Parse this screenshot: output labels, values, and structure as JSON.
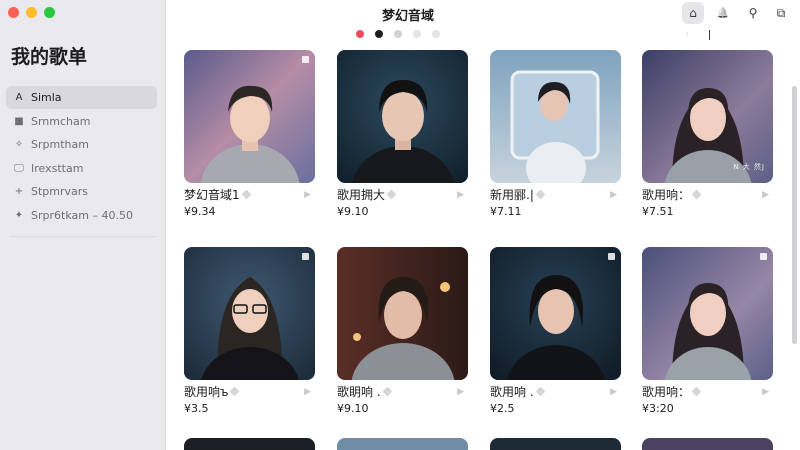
{
  "window": {
    "title": "梦幻音域"
  },
  "sidebar": {
    "title": "我的歌单",
    "items": [
      {
        "label": "Simla",
        "icon": "user-icon",
        "glyph": "A"
      },
      {
        "label": "Srnmcham",
        "icon": "square-icon",
        "glyph": "■"
      },
      {
        "label": "Srpmtham",
        "icon": "sparkle-icon",
        "glyph": "✧"
      },
      {
        "label": "Irexsttam",
        "icon": "monitor-icon",
        "glyph": "🖵"
      },
      {
        "label": "Stpmrvars",
        "icon": "plus-icon",
        "glyph": "+"
      },
      {
        "label": "Srpr6tkam – 40.50",
        "icon": "wand-icon",
        "glyph": "✦"
      }
    ]
  },
  "toolbar": {
    "home_glyph": "⌂",
    "bell_glyph": "🔔",
    "pin_glyph": "⚲",
    "share_glyph": "⧉"
  },
  "carousel": {
    "mark": "⁽"
  },
  "cards": [
    {
      "title": "梦幻音域1",
      "price": "¥9.34",
      "overlay": ""
    },
    {
      "title": "歌用拥大",
      "price": "¥9.10",
      "overlay": ""
    },
    {
      "title": "新用郦.|",
      "price": "¥7.11",
      "overlay": ""
    },
    {
      "title": "歌用响：",
      "price": "¥7.51",
      "overlay": "N 大 然J"
    },
    {
      "title": "歌用响ъ",
      "price": "¥3.5",
      "overlay": ""
    },
    {
      "title": "歌眀响 .",
      "price": "¥9.10",
      "overlay": ""
    },
    {
      "title": "歌用响 .",
      "price": "¥2.5",
      "overlay": ""
    },
    {
      "title": "歌用响：",
      "price": "¥3:20",
      "overlay": ""
    }
  ],
  "colors": {
    "accent_red": "#f04b5c"
  }
}
